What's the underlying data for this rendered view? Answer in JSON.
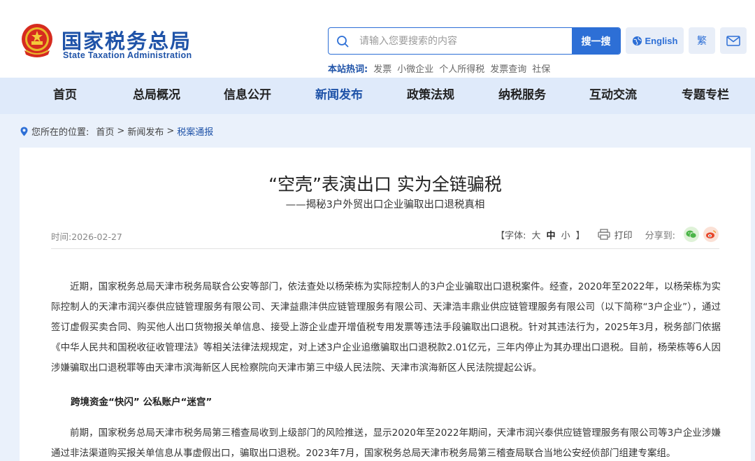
{
  "header": {
    "logo_cn": "国家税务总局",
    "logo_en": "State Taxation Administration",
    "search": {
      "placeholder": "请输入您要搜索的内容",
      "button": "搜一搜"
    },
    "hot_label": "本站热词:",
    "hot_words": [
      "发票",
      "小微企业",
      "个人所得税",
      "发票查询",
      "社保"
    ],
    "english_label": "English",
    "traditional_label": "繁"
  },
  "nav": {
    "items": [
      "首页",
      "总局概况",
      "信息公开",
      "新闻发布",
      "政策法规",
      "纳税服务",
      "互动交流",
      "专题专栏"
    ],
    "active": "新闻发布"
  },
  "breadcrumb": {
    "prefix": "您所在的位置:",
    "home": "首页",
    "sep": ">",
    "level1": "新闻发布",
    "current": "税案通报"
  },
  "article": {
    "title": "“空壳”表演出口 实为全链骗税",
    "subtitle": "——揭秘3户外贸出口企业骗取出口退税真相",
    "time": "时间:2026-02-27",
    "font_label": "【字体:",
    "font_large": "大",
    "font_medium": "中",
    "font_small": "小",
    "font_close": "】",
    "print_label": "打印",
    "share_label": "分享到:",
    "paragraph1": "近期，国家税务总局天津市税务局联合公安等部门，依法查处以杨荣栋为实际控制人的3户企业骗取出口退税案件。经查，2020年至2022年，以杨荣栋为实际控制人的天津市润兴泰供应链管理服务有限公司、天津益鼎沣供应链管理服务有限公司、天津浩丰鼎业供应链管理服务有限公司（以下简称“3户企业”），通过签订虚假买卖合同、购买他人出口货物报关单信息、接受上游企业虚开增值税专用发票等违法手段骗取出口退税。针对其违法行为，2025年3月，税务部门依据《中华人民共和国税收征收管理法》等相关法律法规规定，对上述3户企业追缴骗取出口退税款2.01亿元，三年内停止为其办理出口退税。目前，杨荣栋等6人因涉嫌骗取出口退税罪等由天津市滨海新区人民检察院向天津市第三中级人民法院、天津市滨海新区人民法院提起公诉。",
    "section_head": "跨境资金“快闪” 公私账户“迷宫”",
    "paragraph2": "前期，国家税务总局天津市税务局第三稽查局收到上级部门的风险推送，显示2020年至2022年期间，天津市润兴泰供应链管理服务有限公司等3户企业涉嫌通过非法渠道购买报关单信息从事虚假出口，骗取出口退税。2023年7月，国家税务总局天津市税务局第三稽查局联合当地公安经侦部门组建专案组。"
  },
  "colors": {
    "brand_blue": "#1f53a8",
    "accent_blue": "#2d6fd6",
    "nav_bg": "#dfeafa",
    "page_bg": "#eaf1fb"
  }
}
